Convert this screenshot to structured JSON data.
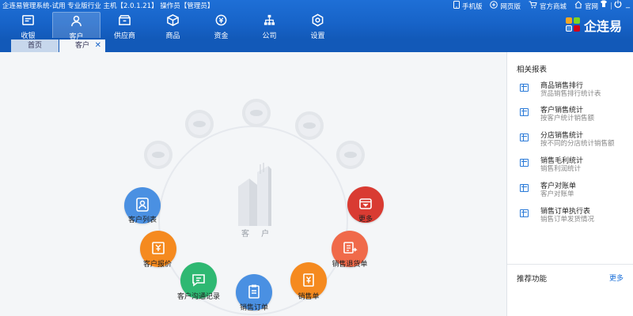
{
  "window": {
    "title": "企连易管理系统-试用 专业版行业 主机【2.0.1.21】 操作员【管理员】"
  },
  "toplinks": [
    {
      "label": "手机版",
      "icon": "phone-icon"
    },
    {
      "label": "网页版",
      "icon": "web-icon"
    },
    {
      "label": "官方商城",
      "icon": "cart-icon"
    },
    {
      "label": "官网",
      "icon": "home-icon"
    }
  ],
  "nav": [
    {
      "label": "收银",
      "icon": "cashier-icon"
    },
    {
      "label": "客户",
      "icon": "customer-icon",
      "active": true
    },
    {
      "label": "供应商",
      "icon": "supplier-icon"
    },
    {
      "label": "商品",
      "icon": "product-icon"
    },
    {
      "label": "资金",
      "icon": "money-icon"
    },
    {
      "label": "公司",
      "icon": "org-icon"
    },
    {
      "label": "设置",
      "icon": "settings-icon"
    }
  ],
  "logo": {
    "text": "企连易"
  },
  "tabs": [
    {
      "label": "首页"
    },
    {
      "label": "客户",
      "closable": true
    }
  ],
  "hub": {
    "center_label": "客 户",
    "nodes": [
      {
        "label": "客户列表",
        "color": "#4a90e2",
        "icon": "user-icon"
      },
      {
        "label": "客户报价",
        "color": "#f58a1f",
        "icon": "quote-icon"
      },
      {
        "label": "客户沟通记录",
        "color": "#2eb872",
        "icon": "chat-icon"
      },
      {
        "label": "销售订单",
        "color": "#4a90e2",
        "icon": "order-icon"
      },
      {
        "label": "销售单",
        "color": "#f58a1f",
        "icon": "sale-icon"
      },
      {
        "label": "销售退货单",
        "color": "#f06a4a",
        "icon": "return-icon"
      },
      {
        "label": "更多",
        "color": "#d93b32",
        "icon": "more-icon"
      }
    ]
  },
  "right_panel": {
    "title": "相关报表",
    "reports": [
      {
        "title": "商品销售排行",
        "desc": "货品销售排行统计表"
      },
      {
        "title": "客户销售统计",
        "desc": "按客户统计销售额"
      },
      {
        "title": "分店销售统计",
        "desc": "按不同的分店统计销售额"
      },
      {
        "title": "销售毛利统计",
        "desc": "销售利润统计"
      },
      {
        "title": "客户对账单",
        "desc": "客户对账单"
      },
      {
        "title": "销售订单执行表",
        "desc": "销售订单发货情况"
      }
    ],
    "recommend_title": "推荐功能",
    "more_label": "更多"
  }
}
